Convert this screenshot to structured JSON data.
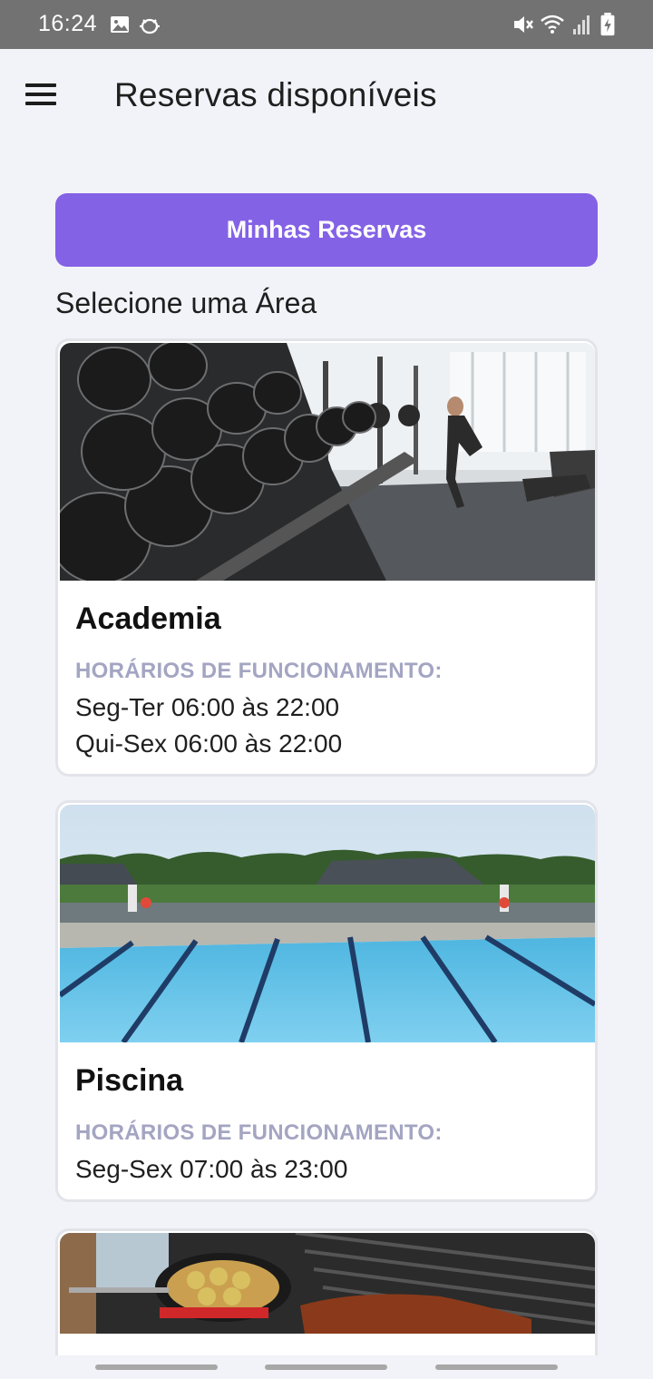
{
  "status_bar": {
    "time": "16:24",
    "left_icons": [
      "image-icon",
      "bug-icon"
    ],
    "right_icons": [
      "mute-icon",
      "wifi-icon",
      "signal-icon",
      "battery-icon"
    ]
  },
  "app_bar": {
    "title": "Reservas disponíveis",
    "menu_icon": "menu-icon"
  },
  "my_reservations_button": "Minhas Reservas",
  "section_label": "Selecione uma Área",
  "areas": [
    {
      "name": "Academia",
      "hours_label": "HORÁRIOS DE FUNCIONAMENTO:",
      "hours": [
        "Seg-Ter 06:00 às 22:00",
        "Qui-Sex 06:00 às 22:00"
      ],
      "image": "gym-photo"
    },
    {
      "name": "Piscina",
      "hours_label": "HORÁRIOS DE FUNCIONAMENTO:",
      "hours": [
        "Seg-Sex 07:00 às 23:00"
      ],
      "image": "pool-photo"
    },
    {
      "image": "grill-photo"
    }
  ],
  "colors": {
    "accent": "#8462e6",
    "background": "#f2f3f8",
    "status_bar": "#727272",
    "muted_label": "#a3a5c2"
  }
}
